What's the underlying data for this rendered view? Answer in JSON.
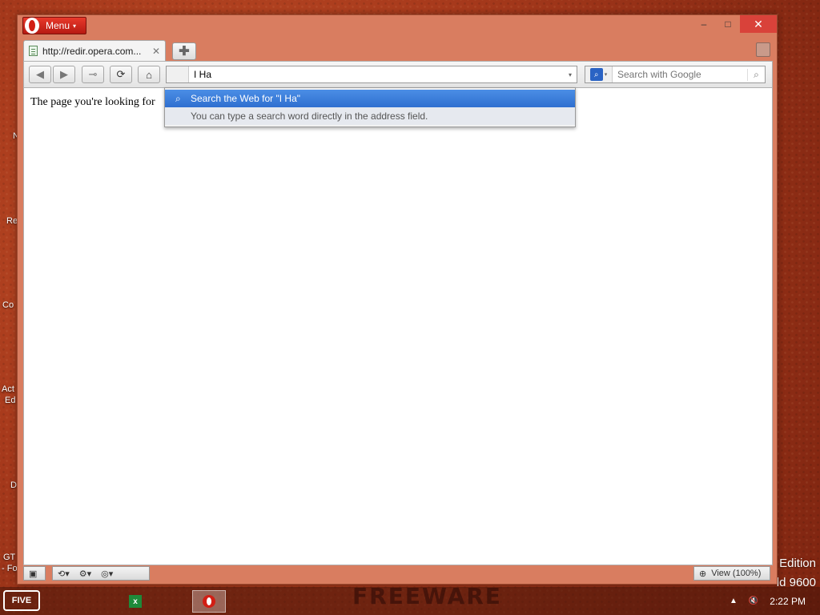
{
  "desktop": {
    "labels": [
      "N",
      "Re",
      "Co",
      "Act",
      "Ed",
      "D",
      "GT",
      "- Fo"
    ],
    "edition": {
      "line1": "Edition",
      "line2": "ld 9600"
    },
    "watermark": "FREEWARE"
  },
  "window": {
    "menu_label": "Menu",
    "controls": {
      "minimize": "–",
      "maximize": "□",
      "close": "✕"
    }
  },
  "tabs": [
    {
      "title": "http://redir.opera.com...",
      "close": "✕"
    }
  ],
  "new_tab_label": "✚",
  "toolbar": {
    "back": "◀",
    "forward": "▶",
    "key": "⊸",
    "reload": "⟳",
    "home": "⌂"
  },
  "address": {
    "value": "I Ha",
    "dropdown": "▾"
  },
  "search": {
    "placeholder": "Search with Google",
    "go": "⌕",
    "engine_caret": "▾"
  },
  "suggestions": {
    "active": "Search the Web for \"I Ha\"",
    "hint": "You can type a search word directly in the address field."
  },
  "content": {
    "text": "The page you're looking for"
  },
  "statusbar": {
    "view": "View (100%)"
  },
  "taskbar": {
    "gtav": "FIVE",
    "clock": "2:22 PM"
  }
}
